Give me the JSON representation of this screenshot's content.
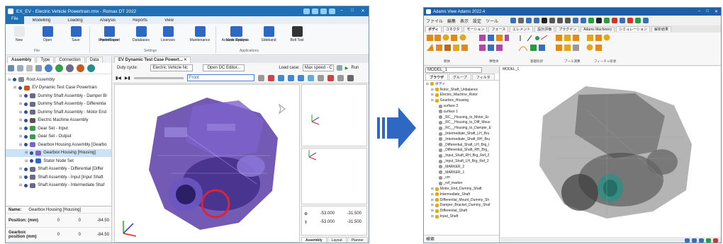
{
  "romax": {
    "title": "EX_EV - Electric Vehicle Powertrain.rmx - Romax DT 2022",
    "file_tab": "File",
    "ribbon_tabs": [
      "Modelling",
      "Loading",
      "Analysis",
      "Reports",
      "View"
    ],
    "ribbon": {
      "file_buttons": [
        "New",
        "Open",
        "Save",
        "Import/Export"
      ],
      "file_group": "File",
      "settings_buttons": [
        "Preferences",
        "Databases",
        "Licenses",
        "Maintenance",
        "More Options"
      ],
      "settings_group": "Settings",
      "app_buttons": [
        "Acoustic Analysis",
        "Sideband",
        "Bolt Tool"
      ],
      "apps_group": "Applications"
    },
    "left_tabs": [
      "Assembly",
      "Type",
      "Connection",
      "Data"
    ],
    "tree": [
      {
        "label": "Root Assembly",
        "indent": 0
      },
      {
        "label": "EV Dynamic Test Case Powertrain",
        "indent": 1
      },
      {
        "label": "Dummy Shaft Assembly - Damper Br",
        "indent": 2
      },
      {
        "label": "Dummy Shaft Assembly - Differentia",
        "indent": 2
      },
      {
        "label": "Dummy Shaft Assembly - Motor End",
        "indent": 2
      },
      {
        "label": "Electric Machine Assembly",
        "indent": 2
      },
      {
        "label": "Gear Set - Input",
        "indent": 2
      },
      {
        "label": "Gear Set - Output",
        "indent": 2
      },
      {
        "label": "Gearbox Housing Assembly [Gearbo",
        "indent": 2
      },
      {
        "label": "Gearbox Housing [Housing]",
        "indent": 3,
        "selected": true
      },
      {
        "label": "Stator Node Set",
        "indent": 3
      },
      {
        "label": "Shaft Assembly - Differential [Differ",
        "indent": 2
      },
      {
        "label": "Shaft Assembly - Input [Input Shaft",
        "indent": 2
      },
      {
        "label": "Shaft Assembly - Intermediate Shaf",
        "indent": 2
      }
    ],
    "props": {
      "name_label": "Name:",
      "name_value": "Gearbox Housing [Housing]",
      "rows": [
        {
          "label": "Position: (mm)",
          "v1": "0",
          "v2": "0",
          "v3": "-84.50"
        },
        {
          "label": "Gearbox position (mm)",
          "v1": "0",
          "v2": "0",
          "v3": "-84.50"
        }
      ]
    },
    "doc_tab": "EV Dynamic Test Case Powert...",
    "duty_label": "Duty cycle:",
    "duty_value": "Electric Vehicle Nc",
    "dc_button": "Open DC Editor...",
    "load_label": "Load case:",
    "load_value": "Max speed - C",
    "run_label": "Run",
    "render_value": "Front",
    "coords": {
      "r1a": "-53.000",
      "r1b": "-31.500",
      "r2a": "-53.000",
      "r2b": "-31.500"
    },
    "bottom_tabs": [
      "Assembly",
      "Layout",
      "Planner"
    ]
  },
  "adams": {
    "title": "Adams View Adams 2022.4",
    "menu": [
      "ファイル",
      "編集",
      "表示",
      "設定",
      "ツール"
    ],
    "ribbon_tabs": [
      "ボディ",
      "コネクタ",
      "モーション",
      "フォース",
      "エレメント",
      "設計評価",
      "プラグイン",
      "Adams Machinery",
      "シミュレーション",
      "解析結果"
    ],
    "groups": [
      "剛体",
      "弾性体",
      "基礎形状",
      "ブール演算",
      "フィーチャ形状"
    ],
    "model_select": "MODEL_1",
    "canvas_label": "MODEL_1",
    "browser_tabs": [
      "ブラウザ",
      "グループ",
      "フィルタ"
    ],
    "tree": [
      {
        "label": "ボディ",
        "indent": 0
      },
      {
        "label": "Rotor_Shaft_Unbalance",
        "indent": 1
      },
      {
        "label": "Electric_Machine_Rotor",
        "indent": 1
      },
      {
        "label": "Gearbox_Housing",
        "indent": 1
      },
      {
        "label": "surface 3",
        "indent": 2
      },
      {
        "label": "surface 1",
        "indent": 2
      },
      {
        "label": "_RC__Housing_to_Motor_Er",
        "indent": 2
      },
      {
        "label": "_RC__Housing_to_Diff_Mous",
        "indent": 2
      },
      {
        "label": "_RC__Housing_to_Damper_E",
        "indent": 2
      },
      {
        "label": "_Intermediate_Shaft_LH_Bru",
        "indent": 2
      },
      {
        "label": "_Intermediate_Shaft_RH_Bru",
        "indent": 2
      },
      {
        "label": "_Differential_Shaft_LH_Brg_Ⅰ",
        "indent": 2
      },
      {
        "label": "_Differential_Shaft_RH_Brg_",
        "indent": 2
      },
      {
        "label": "_Input_Shaft_RH_Brg_Ref_2",
        "indent": 2
      },
      {
        "label": "_Input_Shaft_LH_Brg_Ref_2",
        "indent": 2
      },
      {
        "label": "_MARKER_2",
        "indent": 2
      },
      {
        "label": "_MARKER_1",
        "indent": 2
      },
      {
        "label": "_cm",
        "indent": 2
      },
      {
        "label": "_ref_marker",
        "indent": 2
      },
      {
        "label": "Motor_End_Dummy_Shaft",
        "indent": 1
      },
      {
        "label": "Intermediate_Shaft",
        "indent": 1
      },
      {
        "label": "Differential_Mount_Dummy_Sh",
        "indent": 1
      },
      {
        "label": "Damper_Bracket_Dummy_Shaf",
        "indent": 1
      },
      {
        "label": "Differential_Shaft",
        "indent": 1
      },
      {
        "label": "Input_Shaft",
        "indent": 1
      }
    ],
    "search_label": "検索"
  },
  "colors": {
    "romax_title": "#1e6fb5",
    "accent_blue": "#2f68c3",
    "arrow": "#2f68c3",
    "selection": "#cce3f7"
  }
}
